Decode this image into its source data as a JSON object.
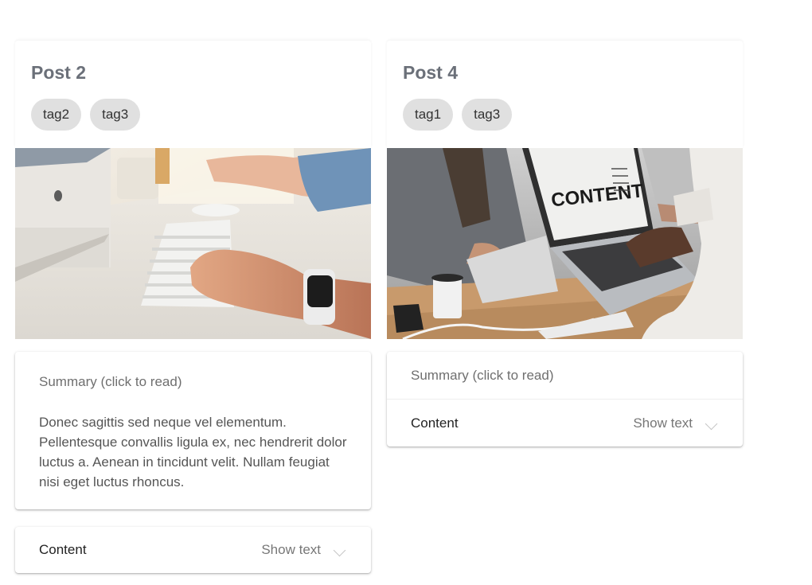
{
  "posts": [
    {
      "title": "Post 2",
      "tags": [
        "tag2",
        "tag3"
      ],
      "image_alt": "hands typing on keyboard with smartwatch",
      "summary_title": "Summary (click to read)",
      "summary_body": "Donec sagittis sed neque vel elementum. Pellentesque convallis ligula ex, nec hendrerit dolor luctus a. Aenean in tincidunt velit. Nullam feugiat nisi eget luctus rhoncus.",
      "content_label": "Content",
      "show_text": "Show text"
    },
    {
      "title": "Post 4",
      "tags": [
        "tag1",
        "tag3"
      ],
      "image_alt": "laptop showing CONTENT slide in meeting",
      "laptop_screen_text": "CONTENT",
      "summary_title": "Summary (click to read)",
      "content_label": "Content",
      "show_text": "Show text"
    }
  ],
  "icons": {
    "expand": "chevron-down-icon"
  },
  "colors": {
    "title": "#6b7079",
    "tag_bg": "#e0e0e0",
    "text_muted": "#6f6f6f"
  }
}
